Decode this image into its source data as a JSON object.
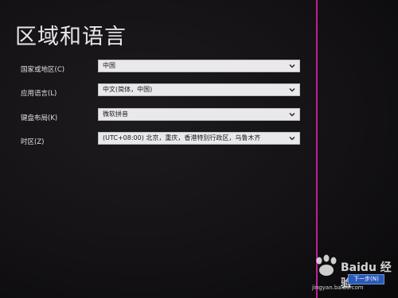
{
  "page": {
    "title": "区域和语言"
  },
  "fields": [
    {
      "label": "国家或地区(C)",
      "value": "中国"
    },
    {
      "label": "应用语言(L)",
      "value": "中文(简体，中国)"
    },
    {
      "label": "键盘布局(K)",
      "value": "微软拼音"
    },
    {
      "label": "时区(Z)",
      "value": "(UTC+08:00) 北京，重庆，香港特别行政区，乌鲁木齐"
    }
  ],
  "footer": {
    "next_label": "下一步(N)"
  },
  "watermark": {
    "brand": "Baidu 经验",
    "url": "jingyan.baidu.com"
  },
  "colors": {
    "accent_line": "#c01f9a",
    "next_button": "#2a5ab8"
  }
}
